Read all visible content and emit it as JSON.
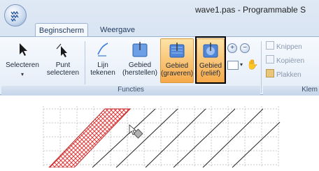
{
  "title_bar": {
    "title": "wave1.pas - Programmable S"
  },
  "tabs": [
    {
      "label": "Beginscherm"
    },
    {
      "label": "Weergave"
    }
  ],
  "ribbon": {
    "groups": {
      "functions": {
        "label": "Functies"
      },
      "clipboard": {
        "label": "Klem"
      }
    },
    "buttons": {
      "select": {
        "label": "Selecteren"
      },
      "point_select": {
        "label": "Punt selecteren"
      },
      "draw_line": {
        "label": "Lijn tekenen"
      },
      "area_restore": {
        "label": "Gebied (herstellen)"
      },
      "area_engrave": {
        "label": "Gebied (graveren)"
      },
      "area_relief": {
        "label": "Gebied (reliëf)"
      }
    },
    "edit": {
      "cut": "Knippen",
      "copy": "Kopiëren",
      "paste": "Plakken"
    }
  },
  "colors": {
    "active_button": "#f6a94a",
    "highlight_box": "#000000",
    "hatch_fill": "#e03a3a"
  },
  "canvas": {
    "description_icons": [
      "arrow-cursor-icon",
      "node-handle-icon"
    ]
  }
}
